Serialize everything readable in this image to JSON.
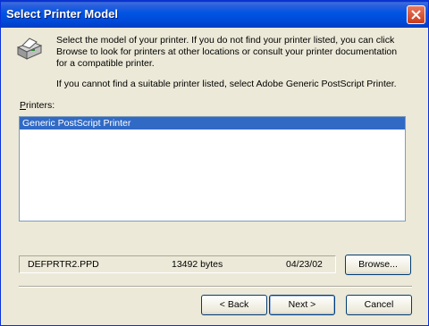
{
  "window": {
    "title": "Select Printer Model"
  },
  "description": {
    "line1": "Select the model of your printer. If you do not find your printer listed, you can click",
    "line2": "Browse to look for printers at other locations or consult your printer documentation",
    "line3": "for a compatible printer.",
    "line4": "If you cannot find a suitable printer listed, select Adobe Generic PostScript Printer."
  },
  "printers": {
    "label": "Printers:",
    "items": [
      "Generic PostScript Printer"
    ],
    "selected_index": 0
  },
  "file_info": {
    "name": "DEFPRTR2.PPD",
    "size": "13492 bytes",
    "date": "04/23/02"
  },
  "buttons": {
    "browse": "Browse...",
    "back": "< Back",
    "next": "Next >",
    "cancel": "Cancel"
  },
  "icons": {
    "printer": "printer-icon",
    "close": "close-icon"
  },
  "colors": {
    "title_bar": "#0054e3",
    "selection": "#316ac5",
    "background": "#ece9d8"
  }
}
